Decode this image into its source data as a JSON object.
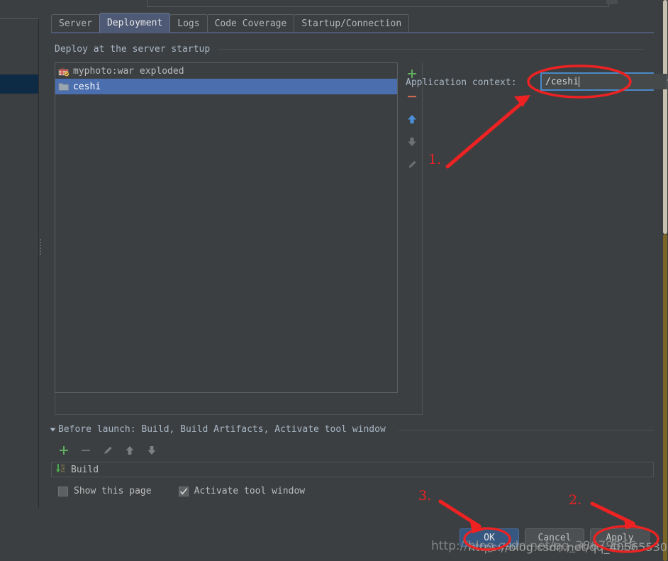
{
  "window": {
    "background_color": "#3c3f41",
    "accent_color": "#4b6eaf",
    "annotation_color": "#ee2222"
  },
  "tabs": [
    {
      "label": "Server",
      "active": false
    },
    {
      "label": "Deployment",
      "active": true
    },
    {
      "label": "Logs",
      "active": false
    },
    {
      "label": "Code Coverage",
      "active": false
    },
    {
      "label": "Startup/Connection",
      "active": false
    }
  ],
  "deploy_section": {
    "title": "Deploy at the server startup",
    "items": [
      {
        "label": "myphoto:war exploded",
        "icon": "artifact-icon",
        "selected": false
      },
      {
        "label": "ceshi",
        "icon": "folder-icon",
        "selected": true
      }
    ],
    "toolbar": [
      {
        "name": "add-button",
        "glyph": "+",
        "color": "#5fad5f"
      },
      {
        "name": "remove-button",
        "glyph": "–",
        "color": "#cc6a5a"
      },
      {
        "name": "move-up-button",
        "glyph": "↑",
        "color": "#4a90d9"
      },
      {
        "name": "move-down-button",
        "glyph": "↓",
        "color": "#6e7173"
      },
      {
        "name": "edit-button",
        "glyph": "✎",
        "color": "#6e7173"
      }
    ]
  },
  "application_context": {
    "label": "Application context:",
    "value": "/ceshi",
    "placeholder": "",
    "dropdown_glyph": "▼"
  },
  "before_launch": {
    "title": "Before launch: Build, Build Artifacts, Activate tool window",
    "toolbar": [
      {
        "name": "add-task-button",
        "glyph": "+",
        "color": "#5fad5f"
      },
      {
        "name": "remove-task-button",
        "glyph": "–",
        "color": "#6e7173"
      },
      {
        "name": "edit-task-button",
        "glyph": "✎",
        "color": "#7d8183"
      },
      {
        "name": "task-move-up-button",
        "glyph": "↑",
        "color": "#7d8183"
      },
      {
        "name": "task-move-down-button",
        "glyph": "↓",
        "color": "#7d8183"
      }
    ],
    "task": {
      "label": "Build",
      "icon": "build-icon"
    },
    "checkboxes": [
      {
        "label": "Show this page",
        "checked": false
      },
      {
        "label": "Activate tool window",
        "checked": true
      }
    ]
  },
  "buttons": [
    {
      "label": "OK",
      "primary": true
    },
    {
      "label": "Cancel",
      "primary": false
    },
    {
      "label": "Apply",
      "primary": false
    }
  ],
  "annotations": {
    "step1": "1.",
    "step2": "2.",
    "step3": "3."
  },
  "watermarks": {
    "line1": "http://blog.csdn.net/qq_38679516",
    "line2": "https://blog.csdn.net/qq_40565530"
  }
}
